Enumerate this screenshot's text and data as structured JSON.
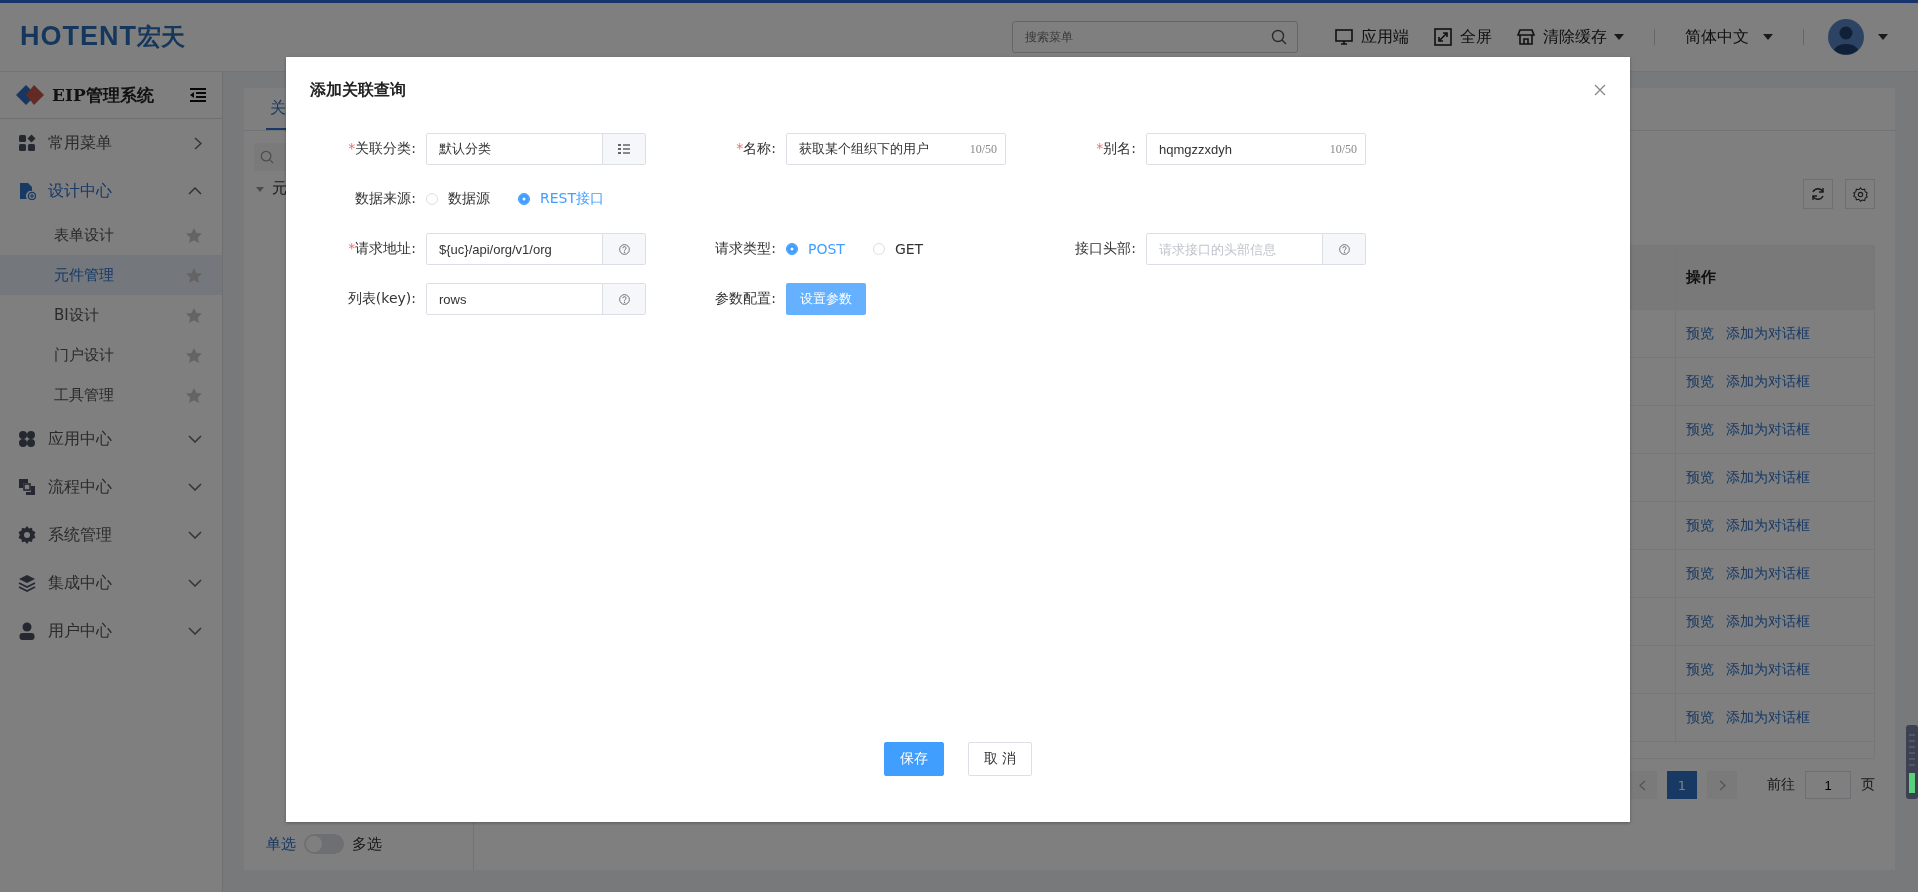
{
  "header": {
    "logo": "HOTENT",
    "logo_cn": "宏天",
    "search": {
      "placeholder": "搜索菜单"
    },
    "actions": [
      {
        "label": "应用端",
        "dropdown": false
      },
      {
        "label": "全屏",
        "dropdown": false
      },
      {
        "label": "清除缓存",
        "dropdown": true
      }
    ],
    "language": "简体中文"
  },
  "sidebar": {
    "title": "EIP管理系统",
    "items": [
      {
        "label": "常用菜单",
        "kind": "flyout",
        "selected": false,
        "expanded": false
      },
      {
        "label": "设计中心",
        "kind": "group",
        "selected": true,
        "expanded": true,
        "children": [
          {
            "label": "表单设计",
            "selected": false
          },
          {
            "label": "元件管理",
            "selected": true
          },
          {
            "label": "BI设计",
            "selected": false
          },
          {
            "label": "门户设计",
            "selected": false
          },
          {
            "label": "工具管理",
            "selected": false
          }
        ]
      },
      {
        "label": "应用中心",
        "kind": "group",
        "selected": false,
        "expanded": false
      },
      {
        "label": "流程中心",
        "kind": "group",
        "selected": false,
        "expanded": false
      },
      {
        "label": "系统管理",
        "kind": "group",
        "selected": false,
        "expanded": false
      },
      {
        "label": "集成中心",
        "kind": "group",
        "selected": false,
        "expanded": false
      },
      {
        "label": "用户中心",
        "kind": "group",
        "selected": false,
        "expanded": false
      }
    ]
  },
  "page": {
    "tabs": [
      {
        "label": "关",
        "selected": true
      }
    ],
    "tree": {
      "label": "元",
      "expanded": true
    },
    "select_mode": {
      "left": "单选",
      "right": "多选",
      "on": false
    },
    "table": {
      "columns": [
        "操作"
      ],
      "rows": [
        {
          "actions": [
            "预览",
            "添加为对话框"
          ]
        },
        {
          "actions": [
            "预览",
            "添加为对话框"
          ]
        },
        {
          "actions": [
            "预览",
            "添加为对话框"
          ]
        },
        {
          "actions": [
            "预览",
            "添加为对话框"
          ]
        },
        {
          "actions": [
            "预览",
            "添加为对话框"
          ]
        },
        {
          "actions": [
            "预览",
            "添加为对话框"
          ]
        },
        {
          "actions": [
            "预览",
            "添加为对话框"
          ]
        },
        {
          "actions": [
            "预览",
            "添加为对话框"
          ]
        },
        {
          "actions": [
            "预览",
            "添加为对话框"
          ]
        }
      ]
    },
    "pagination": {
      "current": "1",
      "goto_label": "前往",
      "goto_value": "1",
      "page_label": "页"
    }
  },
  "dialog": {
    "title": "添加关联查询",
    "rows": [
      [
        {
          "kind": "picker",
          "label": "关联分类:",
          "required_mark": "*",
          "value": "默认分类"
        },
        {
          "kind": "text",
          "label": "名称:",
          "required_mark": "*",
          "value": "获取某个组织下的用户",
          "counter": "10/50"
        },
        {
          "kind": "text",
          "label": "别名:",
          "required_mark": "*",
          "value": "hqmgzzxdyh",
          "counter": "10/50"
        }
      ],
      [
        {
          "kind": "radio",
          "label": "数据来源:",
          "options": [
            {
              "label": "数据源",
              "selected": false
            },
            {
              "label": "REST接口",
              "selected": true
            }
          ]
        }
      ],
      [
        {
          "kind": "help",
          "label": "请求地址:",
          "required_mark": "*",
          "value": "${uc}/api/org/v1/org"
        },
        {
          "kind": "radio",
          "label": "请求类型:",
          "options": [
            {
              "label": "POST",
              "selected": true
            },
            {
              "label": "GET",
              "selected": false
            }
          ]
        },
        {
          "kind": "help",
          "label": "接口头部:",
          "placeholder": "请求接口的头部信息"
        }
      ],
      [
        {
          "kind": "help",
          "label": "列表(key):",
          "value": "rows"
        },
        {
          "kind": "button",
          "label": "参数配置:",
          "button": "设置参数"
        }
      ]
    ],
    "buttons": [
      {
        "label": "保存",
        "kind": "primary"
      },
      {
        "label": "取 消",
        "kind": "default"
      }
    ]
  }
}
